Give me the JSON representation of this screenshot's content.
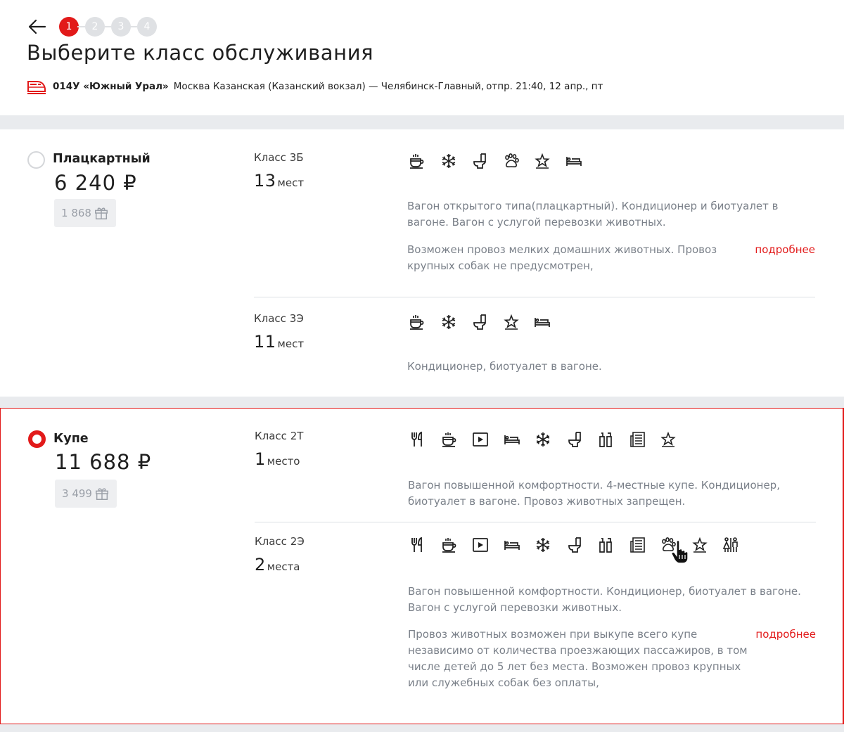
{
  "nav": {
    "steps": [
      "1",
      "2",
      "3",
      "4"
    ],
    "active_step": 1
  },
  "header": {
    "title": "Выберите класс обслуживания",
    "train_number": "014У «Южный Урал»",
    "route": "Москва Казанская (Казанский вокзал) — Челябинск-Главный,",
    "departure": "отпр. 21:40, 12 апр., пт"
  },
  "colors": {
    "accent": "#e21a1a",
    "band": "#e9ebee",
    "muted_text": "#7a8089"
  },
  "classes": [
    {
      "name": "Плацкартный",
      "price": "6 240 ₽",
      "bonus": "1 868",
      "selected": false,
      "cars": [
        {
          "class_label": "Класс 3Б",
          "seats_num": "13",
          "seats_word": "мест",
          "icons": [
            "coffee-icon",
            "snowflake-icon",
            "toilet-icon",
            "paw-icon",
            "star-icon",
            "bed-icon"
          ],
          "description": "Вагон открытого типа(плацкартный). Кондиционер и биотуалет в вагоне. Вагон с услугой перевозки животных.",
          "pet_note": "Возможен провоз мелких домашних животных. Провоз крупных собак не предусмотрен,",
          "more": "подробнее"
        },
        {
          "class_label": "Класс 3Э",
          "seats_num": "11",
          "seats_word": "мест",
          "icons": [
            "coffee-icon",
            "snowflake-icon",
            "toilet-icon",
            "star-icon",
            "bed-icon"
          ],
          "description": "Кондиционер, биотуалет в вагоне."
        }
      ]
    },
    {
      "name": "Купе",
      "price": "11 688 ₽",
      "bonus": "3 499",
      "selected": true,
      "cars": [
        {
          "class_label": "Класс 2Т",
          "seats_num": "1",
          "seats_word": "место",
          "icons": [
            "food-icon",
            "coffee-icon",
            "video-icon",
            "bed-icon",
            "snowflake-icon",
            "toilet-icon",
            "hygiene-kit-icon",
            "newspaper-icon",
            "star-icon"
          ],
          "description": "Вагон повышенной комфортности. 4-местные купе. Кондиционер, биотуалет в вагоне. Провоз животных запрещен."
        },
        {
          "class_label": "Класс 2Э",
          "seats_num": "2",
          "seats_word": "места",
          "icons": [
            "food-icon",
            "coffee-icon",
            "video-icon",
            "bed-icon",
            "snowflake-icon",
            "toilet-icon",
            "hygiene-kit-icon",
            "newspaper-icon",
            "paw-icon",
            "star-icon",
            "gender-compartment-icon"
          ],
          "description": "Вагон повышенной комфортности. Кондиционер, биотуалет в вагоне. Вагон с услугой перевозки животных.",
          "pet_note": "Провоз животных возможен при выкупе всего купе независимо от количества проезжающих пассажиров, в том числе детей до 5 лет без места. Возможен провоз крупных или служебных собак без оплаты,",
          "more": "подробнее"
        }
      ]
    }
  ]
}
